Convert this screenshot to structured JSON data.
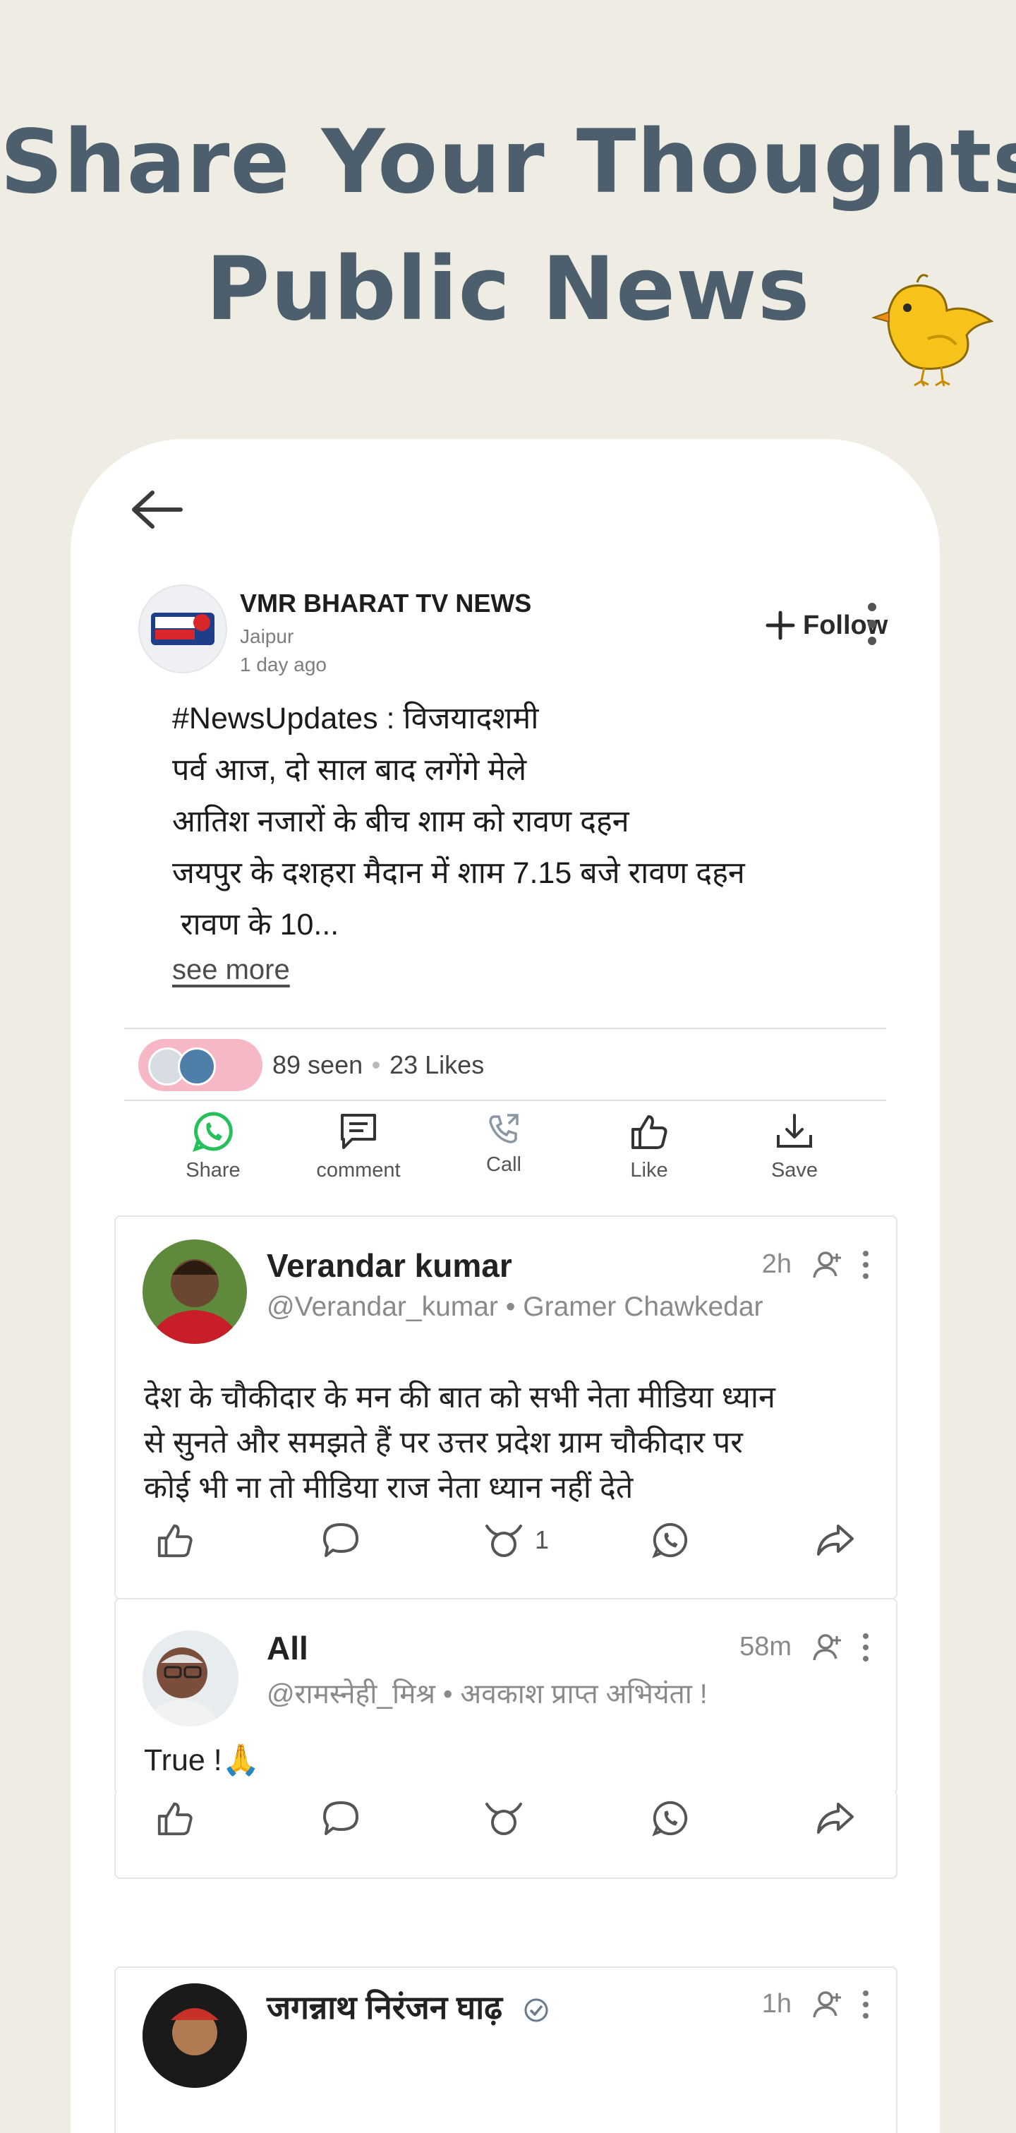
{
  "banner": {
    "line1": "Share Your Thoughts",
    "line2": "Public News"
  },
  "post": {
    "author": "VMR BHARAT TV NEWS",
    "location": "Jaipur",
    "time": "1 day ago",
    "follow_label": "Follow",
    "body": [
      "#NewsUpdates : विजयादशमी",
      "पर्व आज, दो साल बाद लगेंगे मेले",
      "आतिश नजारों के बीच शाम को रावण दहन",
      "जयपुर के दशहरा मैदान में शाम 7.15 बजे रावण दहन",
      " रावण के 10..."
    ],
    "see_more": "see more",
    "seen": "89 seen",
    "likes": "23 Likes",
    "actions": {
      "share": "Share",
      "comment": "comment",
      "call": "Call",
      "like": "Like",
      "save": "Save"
    }
  },
  "comments": [
    {
      "name": "Verandar kumar",
      "handle": "@Verandar_kumar • Gramer  Chawkedar",
      "time": "2h",
      "text": [
        "देश के चौकीदार के मन की बात को सभी नेता मीडिया ध्यान",
        "से सुनते और समझते हैं पर उत्तर प्रदेश ग्राम चौकीदार पर",
        "कोई भी ना तो मीडिया राज नेता ध्यान नहीं देते"
      ],
      "cheers_count": "1"
    },
    {
      "name": "All",
      "handle": "@रामस्नेही_मिश्र • अवकाश प्राप्त अभियंता !",
      "time": "58m",
      "text": [
        "True !🙏"
      ]
    },
    {
      "name": "जगन्नाथ निरंजन घाढ़",
      "time": "1h"
    }
  ],
  "colors": {
    "page_bg": "#efede3",
    "headline": "#4d5f6d",
    "whatsapp": "#25c05b",
    "seen_pill": "#f7b8c6"
  }
}
